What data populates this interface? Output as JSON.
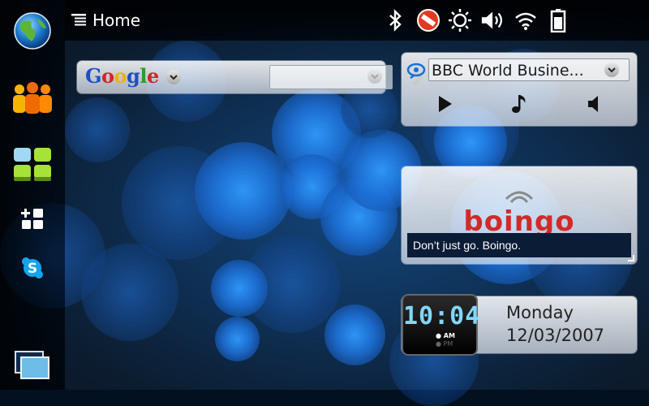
{
  "statusbar": {
    "title": "Home",
    "icons": [
      "bluetooth-icon",
      "presence-offline-icon",
      "display-brightness-icon",
      "volume-icon",
      "wifi-icon",
      "battery-icon"
    ]
  },
  "sidebar": {
    "items": [
      "web-browser-globe-icon",
      "contacts-icon",
      "applications-menu-icon",
      "add-widget-icon",
      "skype-icon",
      "task-switcher-icon"
    ]
  },
  "google": {
    "logo_text": "Google",
    "search_value": ""
  },
  "radio": {
    "station": "BBC World Busine..."
  },
  "boingo": {
    "logo": "boingo",
    "tagline": "Don’t just go. Boingo."
  },
  "clock": {
    "time": "10:04",
    "am": "AM",
    "pm": "PM",
    "day": "Monday",
    "date": "12/03/2007"
  },
  "colors": {
    "accent_blue": "#1a6fd6",
    "boingo_red": "#d02a2a",
    "clock_digits": "#7fd7ff"
  }
}
